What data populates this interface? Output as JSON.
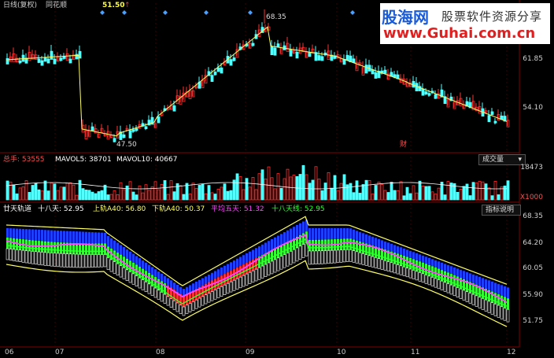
{
  "header": {
    "chart_type": "日线(复权)",
    "source": "同花顺",
    "marker_value": "51.50",
    "marker_arrow": "↑"
  },
  "watermark": {
    "title": "股海网",
    "subtitle": "股票软件资源分享",
    "url": "www.Guhai.com.cn"
  },
  "price_panel": {
    "high_label": "68.35",
    "low_label": "47.50",
    "badge": "财",
    "axis": [
      "61.85",
      "54.10"
    ]
  },
  "volume_panel": {
    "label_total": "总手: 53555",
    "label_mavol5": "MAVOL5: 38701",
    "label_mavol10": "MAVOL10: 40667",
    "dropdown": "成交量",
    "axis_top": "18473",
    "axis_bottom": "X1000"
  },
  "indicator_panel": {
    "name": "廿天轨道",
    "l1": "十八天: 52.95",
    "l2": "上轨A40: 56.80",
    "l3": "下轨A40: 50.37",
    "l4": "平均五天: 51.32",
    "l5": "十八天线: 52.95",
    "help_button": "指标说明",
    "axis": [
      "68.35",
      "64.20",
      "60.05",
      "55.90",
      "51.75"
    ]
  },
  "x_axis": [
    "06",
    "07",
    "08",
    "09",
    "10",
    "11",
    "12"
  ],
  "colors": {
    "up": "#ff3030",
    "down": "#54ffff",
    "upper_band": "#1f3fff",
    "lower_band": "#ffffff",
    "band_line": "#ffff66",
    "ma_magenta": "#ff44ff",
    "ma_green": "#33ff33"
  }
}
